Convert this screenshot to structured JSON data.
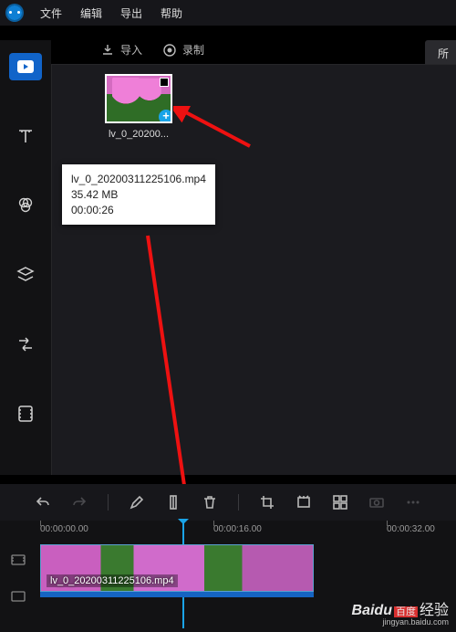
{
  "menu": {
    "file": "文件",
    "edit": "编辑",
    "export": "导出",
    "help": "帮助"
  },
  "top": {
    "import": "导入",
    "record": "录制",
    "right_chip": "所"
  },
  "clip": {
    "name_short": "lv_0_20200..."
  },
  "tooltip": {
    "filename": "lv_0_20200311225106.mp4",
    "size": "35.42 MB",
    "duration": "00:00:26"
  },
  "timeline": {
    "t0": "00:00:00.00",
    "t1": "00:00:16.00",
    "t2": "00:00:32.00",
    "clip_label": "lv_0_20200311225106.mp4"
  },
  "watermark": {
    "brand": "Baidu",
    "suffix": "经验",
    "url": "jingyan.baidu.com",
    "du": "百度"
  }
}
